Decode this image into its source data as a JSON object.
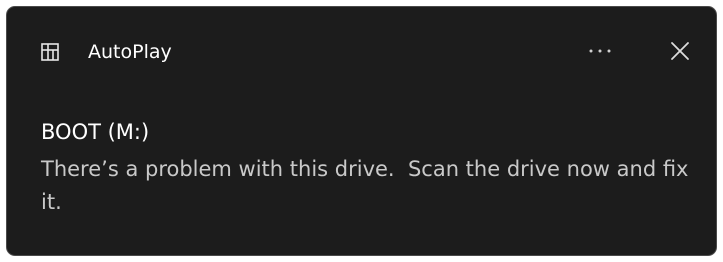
{
  "notification": {
    "app_name": "AutoPlay",
    "app_icon": "autoplay-icon",
    "more_icon": "more-options-icon",
    "close_icon": "close-icon",
    "drive_title": "BOOT (M:)",
    "message": "There’s a problem with this drive.  Scan the drive now and fix it."
  },
  "colors": {
    "background": "#1c1c1c",
    "border": "#4a4a4a",
    "title_text": "#ffffff",
    "body_text": "#c9c9c9",
    "icon": "#d6d6d6"
  }
}
